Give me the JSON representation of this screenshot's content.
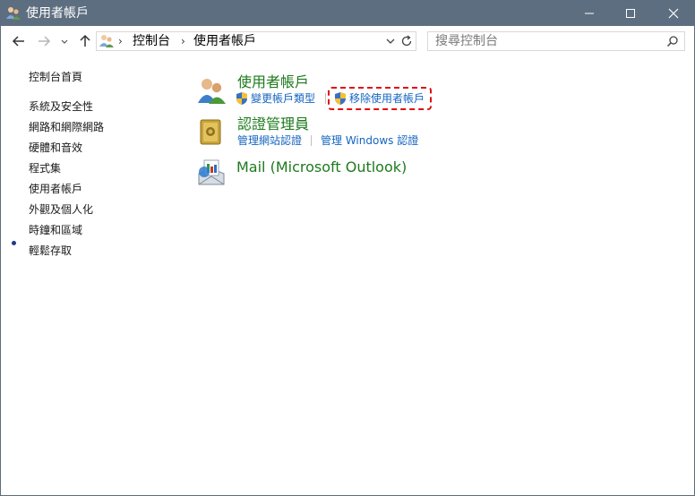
{
  "window": {
    "title": "使用者帳戶",
    "buttons": {
      "minimize": "minimize-icon",
      "maximize": "maximize-icon",
      "close": "close-icon"
    }
  },
  "nav": {
    "breadcrumb": [
      "控制台",
      "使用者帳戶"
    ],
    "search_placeholder": "搜尋控制台"
  },
  "sidebar": {
    "items": [
      {
        "label": "控制台首頁"
      },
      {
        "label": "系統及安全性"
      },
      {
        "label": "網路和網際網路"
      },
      {
        "label": "硬體和音效"
      },
      {
        "label": "程式集"
      },
      {
        "label": "使用者帳戶",
        "active": true
      },
      {
        "label": "外觀及個人化"
      },
      {
        "label": "時鐘和區域"
      },
      {
        "label": "輕鬆存取"
      }
    ]
  },
  "main": {
    "categories": [
      {
        "title": "使用者帳戶",
        "links": [
          "變更帳戶類型",
          "移除使用者帳戶"
        ]
      },
      {
        "title": "認證管理員",
        "links": [
          "管理網站認證",
          "管理 Windows 認證"
        ]
      },
      {
        "title": "Mail (Microsoft Outlook)",
        "links": []
      }
    ]
  },
  "colors": {
    "titlebar": "#5d6e80",
    "category_title": "#1d7a1d",
    "link": "#1565c0",
    "highlight": "#e01010"
  }
}
